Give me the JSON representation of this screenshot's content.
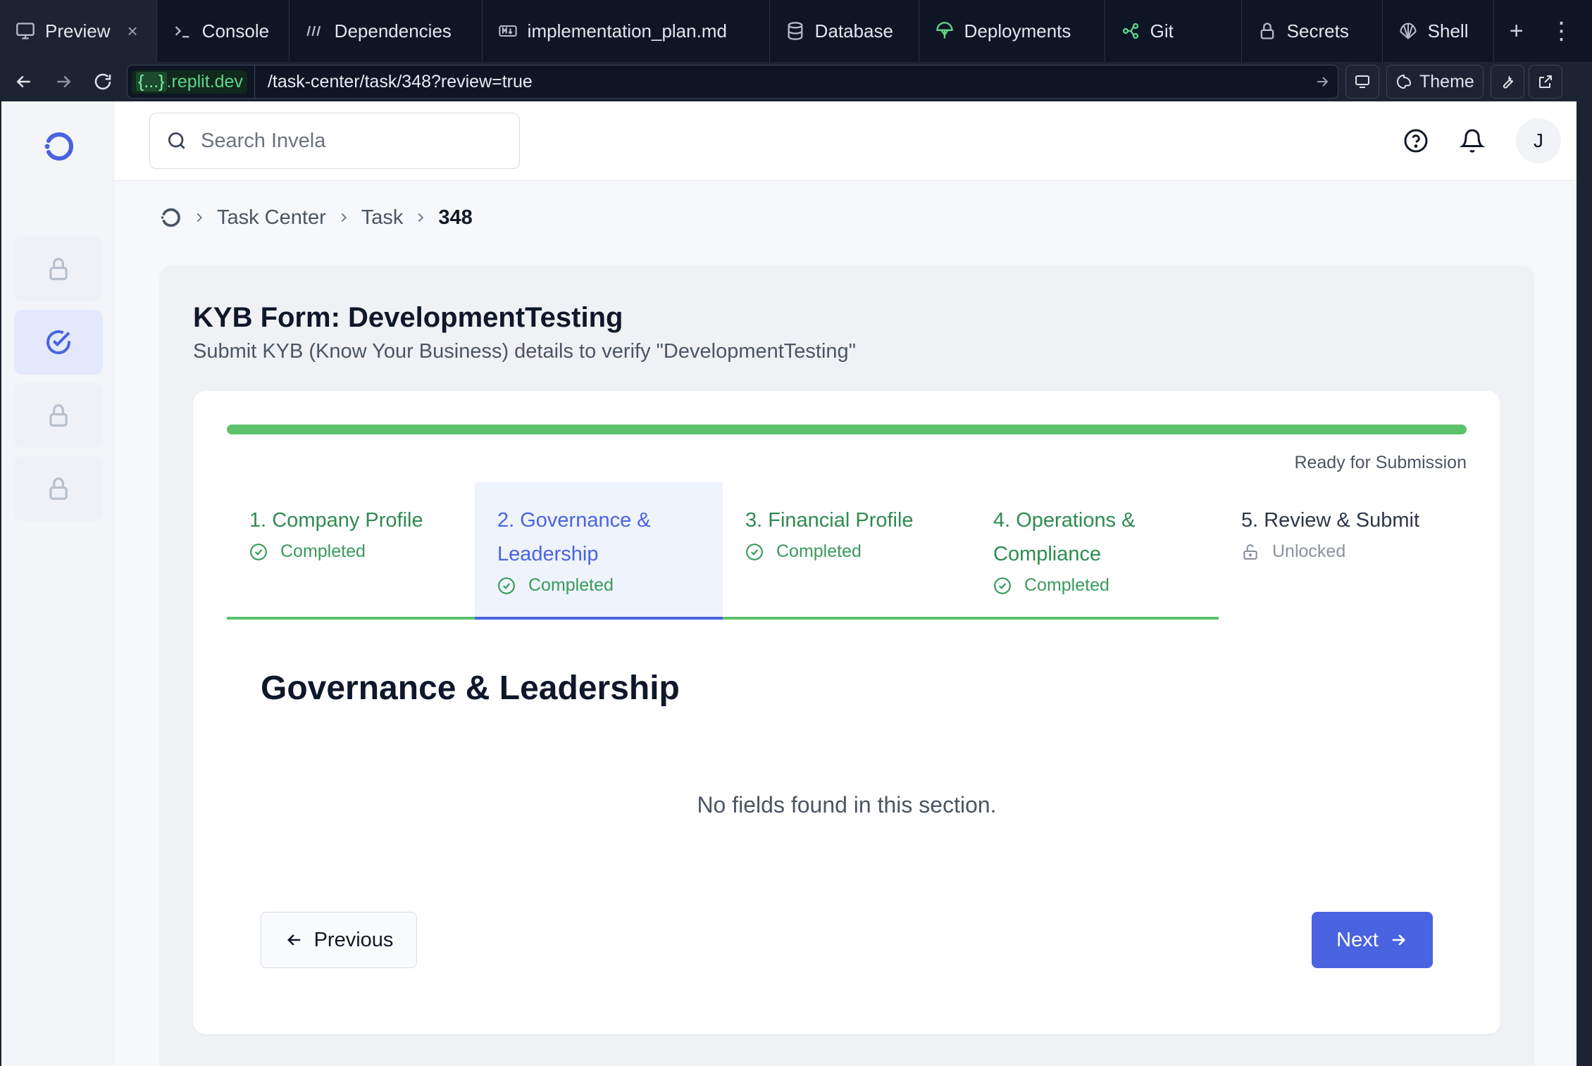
{
  "browser": {
    "tabs": [
      {
        "label": "Preview",
        "icon": "monitor-icon",
        "active": true
      },
      {
        "label": "Console",
        "icon": "terminal-icon"
      },
      {
        "label": "Dependencies",
        "icon": "dependencies-icon"
      },
      {
        "label": "implementation_plan.md",
        "icon": "markdown-icon"
      },
      {
        "label": "Database",
        "icon": "database-icon"
      },
      {
        "label": "Deployments",
        "icon": "deployments-icon"
      },
      {
        "label": "Git",
        "icon": "git-icon"
      },
      {
        "label": "Secrets",
        "icon": "lock-icon"
      },
      {
        "label": "Shell",
        "icon": "shell-icon"
      }
    ],
    "close_glyph": "×",
    "add_tab_glyph": "+",
    "more_glyph": "⋮",
    "url_host_badge": "{...}",
    "url_host": ".replit.dev",
    "url_path": "/task-center/task/348?review=true",
    "theme_label": "Theme"
  },
  "app": {
    "search_placeholder": "Search Invela",
    "avatar_initial": "J",
    "rail_items": [
      {
        "state": "locked",
        "icon": "lock-icon"
      },
      {
        "state": "active",
        "icon": "check-circle-icon"
      },
      {
        "state": "locked",
        "icon": "lock-icon"
      },
      {
        "state": "locked",
        "icon": "lock-icon"
      }
    ]
  },
  "breadcrumb": {
    "items": [
      "Task Center",
      "Task"
    ],
    "current": "348"
  },
  "form": {
    "title": "KYB Form: DevelopmentTesting",
    "subtitle": "Submit KYB (Know Your Business) details to verify \"DevelopmentTesting\"",
    "progress_percent": 100,
    "progress_status": "Ready for Submission",
    "steps": [
      {
        "title": "1. Company Profile",
        "status": "Completed",
        "state": "completed"
      },
      {
        "title": "2. Governance & Leadership",
        "status": "Completed",
        "state": "active"
      },
      {
        "title": "3. Financial Profile",
        "status": "Completed",
        "state": "completed"
      },
      {
        "title": "4. Operations & Compliance",
        "status": "Completed",
        "state": "completed"
      },
      {
        "title": "5. Review & Submit",
        "status": "Unlocked",
        "state": "unlocked"
      }
    ],
    "section_title": "Governance & Leadership",
    "empty_message": "No fields found in this section.",
    "prev_label": "Previous",
    "next_label": "Next"
  },
  "colors": {
    "accent": "#4a63e0",
    "success": "#5cc26b",
    "chrome_bg": "#0e1525"
  }
}
